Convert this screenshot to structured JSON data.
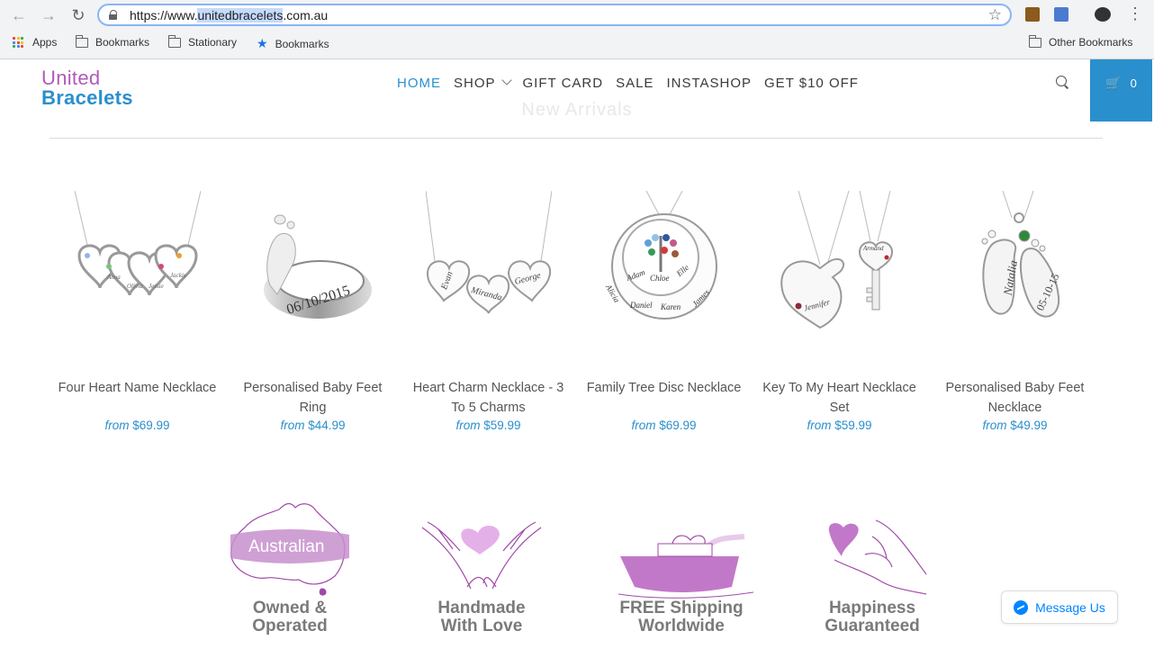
{
  "browser": {
    "url_prefix": "https://www.",
    "url_selected": "unitedbracelets",
    "url_suffix": ".com.au",
    "bookmarks": [
      {
        "label": "Apps",
        "icon": "apps-grid-icon"
      },
      {
        "label": "Bookmarks",
        "icon": "folder-icon"
      },
      {
        "label": "Stationary",
        "icon": "folder-icon"
      },
      {
        "label": "Bookmarks",
        "icon": "star-icon"
      }
    ],
    "other_bookmarks": "Other Bookmarks"
  },
  "site": {
    "logo_line1": "United",
    "logo_line2": "Bracelets",
    "nav": [
      {
        "label": "HOME",
        "active": true
      },
      {
        "label": "SHOP",
        "dropdown": true
      },
      {
        "label": "GIFT CARD"
      },
      {
        "label": "SALE"
      },
      {
        "label": "INSTASHOP"
      },
      {
        "label": "GET $10 OFF"
      }
    ],
    "cart_count": "0",
    "section_title": "New Arrivals",
    "brand_colors": {
      "blue": "#2a8fcd",
      "purple": "#b15ab8"
    }
  },
  "products": [
    {
      "name": "Four Heart Name Necklace",
      "from": "from",
      "price": "$69.99",
      "image": "four-heart-necklace"
    },
    {
      "name": "Personalised Baby Feet Ring",
      "from": "from",
      "price": "$44.99",
      "image": "baby-feet-ring",
      "engraving": "06/10/2015"
    },
    {
      "name": "Heart Charm Necklace - 3 To 5 Charms",
      "from": "from",
      "price": "$59.99",
      "image": "heart-charm-necklace",
      "engravings": [
        "Evan",
        "Miranda",
        "George"
      ]
    },
    {
      "name": "Family Tree Disc Necklace",
      "from": "from",
      "price": "$69.99",
      "image": "family-tree-disc",
      "engravings": [
        "Adam",
        "Chloe",
        "Elle",
        "Alicia",
        "Daniel",
        "Karen",
        "James"
      ]
    },
    {
      "name": "Key To My Heart Necklace Set",
      "from": "from",
      "price": "$59.99",
      "image": "key-heart-set",
      "engravings": [
        "Jennifer",
        "Armand"
      ]
    },
    {
      "name": "Personalised Baby Feet Necklace",
      "from": "from",
      "price": "$49.99",
      "image": "baby-feet-necklace",
      "engravings": [
        "Natalia",
        "05-10-15"
      ]
    }
  ],
  "features": [
    {
      "caption1": "Owned &",
      "caption2": "Operated",
      "art_text": "Australian",
      "icon": "australia-map-icon"
    },
    {
      "caption1": "Handmade",
      "caption2": "With Love",
      "icon": "hands-heart-icon"
    },
    {
      "caption1": "FREE Shipping",
      "caption2": "Worldwide",
      "icon": "ship-icon"
    },
    {
      "caption1": "Happiness",
      "caption2": "Guaranteed",
      "icon": "hand-heart-icon"
    }
  ],
  "messenger_label": "Message Us"
}
